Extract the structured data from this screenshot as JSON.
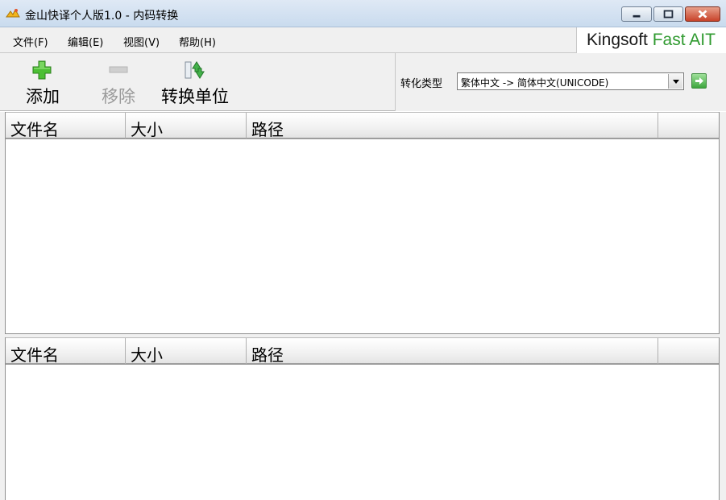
{
  "window": {
    "title": "金山快译个人版1.0 - 内码转换",
    "icons": {
      "app": "app-logo-icon",
      "minimize": "minimize-icon",
      "maximize": "maximize-icon",
      "close": "close-icon"
    }
  },
  "menu": {
    "items": [
      "文件(F)",
      "编辑(E)",
      "视图(V)",
      "帮助(H)"
    ],
    "brand_prefix": "Kingsoft ",
    "brand_accent": "Fast AIT"
  },
  "toolbar": {
    "add": {
      "label": "添加",
      "icon": "plus-icon",
      "enabled": true
    },
    "remove": {
      "label": "移除",
      "icon": "minus-icon",
      "enabled": false
    },
    "convert_unit": {
      "label": "转换单位",
      "icon": "convert-arrows-icon",
      "enabled": true
    }
  },
  "conversion": {
    "label": "转化类型",
    "selected": "繁体中文 -> 简体中文(UNICODE)",
    "go_icon": "go-arrow-icon"
  },
  "source_list": {
    "columns": [
      "文件名",
      "大小",
      "路径",
      ""
    ],
    "rows": []
  },
  "result_list": {
    "columns": [
      "文件名",
      "大小",
      "路径",
      ""
    ],
    "rows": []
  },
  "colors": {
    "accent_green": "#2f9a2f",
    "titlebar": "#c9dbee",
    "chrome": "#f0f0f0",
    "close_button": "#c8432a"
  }
}
